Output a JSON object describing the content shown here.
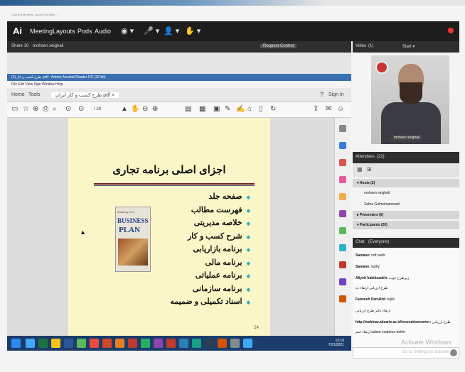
{
  "browser": {
    "hint": "Connect Meeting - Adobe Connect - ..."
  },
  "menubar": {
    "logo": "Ai",
    "items": [
      "Meeting",
      "Layouts",
      "Pods",
      "Audio"
    ],
    "tools": [
      "◉ ▾",
      "🎤 ▾",
      "👤 ▾",
      "✋ ▾"
    ]
  },
  "share_pod": {
    "title": "Share 10",
    "presenter": "mohsen seighali",
    "control": "Request Control"
  },
  "acrobat": {
    "title": "طرح کسب و کار (2) .pdf - Adobe Acrobat Reader DC (32-bit)",
    "menu": "File   Edit   View   Sign   Window   Help",
    "tabs": {
      "home": "Home",
      "tools": "Tools",
      "doc": "طرح کسب و کار ایران.pdf ×",
      "signin": "Sign In"
    },
    "toolbar_zoom": "/ 28"
  },
  "slide": {
    "title": "اجزای اصلی برنامه تجاری",
    "bullets": [
      "صفحه جلد",
      "فهرست مطالب",
      "خلاصه مدیریتی",
      "شرح کسب و کار",
      "برنامه بازاریابی",
      "برنامه مالی",
      "برنامه عملیاتی",
      "برنامه سازمانی",
      "اسناد تکمیلی و ضمیمه"
    ],
    "page_number": "24",
    "book": {
      "top": "Anatomy of a",
      "line1": "BUSINESS",
      "line2": "PLAN"
    }
  },
  "taskbar": {
    "time": "13:10",
    "date": "7/21/2021"
  },
  "video_pod": {
    "title": "Video",
    "count": "(1)",
    "start": "Start ▾",
    "name": "mohsen seighali"
  },
  "attendees": {
    "title": "Attendees",
    "count": "(22)",
    "groups": [
      {
        "label": "▾ Hosts (2)"
      },
      {
        "label": "mohsen seighali"
      },
      {
        "label": "Zahra Golmohammadi"
      },
      {
        "label": "▸ Presenters (0)"
      },
      {
        "label": "▾ Participants (20)"
      }
    ]
  },
  "chat": {
    "title": "Chat",
    "scope": "(Everyone)",
    "messages": [
      {
        "name": "Samane:",
        "text": "raft tasfir"
      },
      {
        "name": "Samane:",
        "text": "tojihy"
      },
      {
        "name": "Aliyeh habibzadeh:",
        "text": "زیرطرح خوب"
      },
      {
        "name": "",
        "text": "طرح ارزیابی ارتقاء ده"
      },
      {
        "name": "Fatemeh Parsikhi:",
        "text": "tojihi"
      },
      {
        "name": "",
        "text": "ارتقاء دکتر طرح ارزیابی"
      },
      {
        "name": "http://webinar.abzaris.ac.ir/innovationcenter:",
        "text": "طرح ارزیابی"
      },
      {
        "name": "",
        "text": "ارتقاء ختم  salam vaqtetun bekhr"
      }
    ],
    "watermark_title": "Activate Windows",
    "watermark_sub": "Go to Settings to activate"
  },
  "colors": {
    "accent": "#2bb0c8",
    "bar": "#2e2e2e",
    "menubar": "#1d1d1d",
    "slide_bg": "#fbf6c8",
    "rule": "#7a1b1b"
  }
}
